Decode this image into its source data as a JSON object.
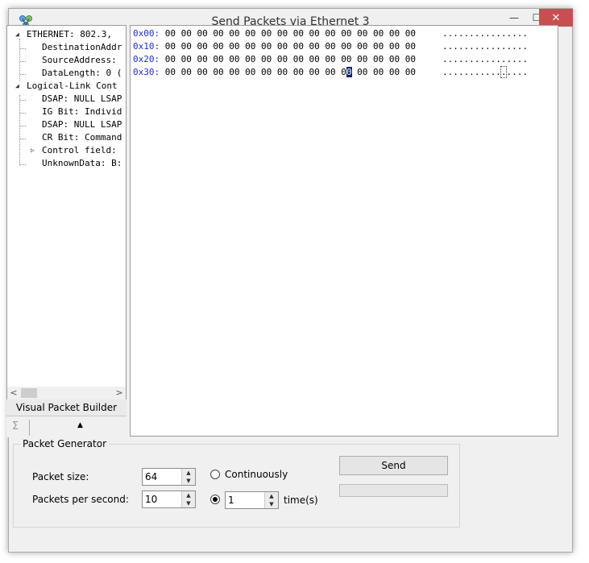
{
  "window": {
    "title": "Send Packets via  Ethernet 3",
    "minimize_glyph": "—",
    "maximize_glyph": "☐",
    "close_glyph": "✕"
  },
  "tree": {
    "nodes": [
      {
        "label": "ETHERNET: 802.3,",
        "expanded": true
      },
      {
        "label": "DestinationAddr"
      },
      {
        "label": "SourceAddress:"
      },
      {
        "label": "DataLength: 0 (",
        "line": true
      },
      {
        "label": "Logical-Link Cont",
        "expanded": true
      },
      {
        "label": "DSAP: NULL LSAP"
      },
      {
        "label": "IG Bit: Individ"
      },
      {
        "label": "DSAP: NULL LSAP"
      },
      {
        "label": "CR Bit: Command"
      },
      {
        "label": "Control field:",
        "collapsed": true
      },
      {
        "label": "UnknownData: B:"
      }
    ],
    "expand_glyph": "◢",
    "collapse_glyph": "▷",
    "scroll_left": "<",
    "scroll_right": ">"
  },
  "tabs": {
    "visual_builder": "Visual Packet Builder",
    "sigma_icon": "Σ",
    "caret_up": "▲"
  },
  "hex": {
    "rows": [
      {
        "offset": "0x00:",
        "bytes": "00 00 00 00 00 00 00 00 00 00 00 00 00 00 00 00",
        "ascii": "................"
      },
      {
        "offset": "0x10:",
        "bytes": "00 00 00 00 00 00 00 00 00 00 00 00 00 00 00 00",
        "ascii": "................"
      },
      {
        "offset": "0x20:",
        "bytes": "00 00 00 00 00 00 00 00 00 00 00 00 00 00 00 00",
        "ascii": "................"
      },
      {
        "offset": "0x30:",
        "bytes_before": "00 00 00 00 00 00 00 00 00 00 00 0",
        "bytes_sel": "0",
        "bytes_after": " 00 00 00 00",
        "ascii_before": "...........",
        "ascii_sel": ".",
        "ascii_after": "...."
      }
    ]
  },
  "generator": {
    "legend": "Packet Generator",
    "packet_size_label": "Packet size:",
    "packet_size_value": "64",
    "pps_label": "Packets per second:",
    "pps_value": "10",
    "continuously_label": "Continuously",
    "times_value": "1",
    "times_label": "time(s)",
    "send_label": "Send",
    "spin_up": "▲",
    "spin_down": "▼",
    "progress": 0
  }
}
